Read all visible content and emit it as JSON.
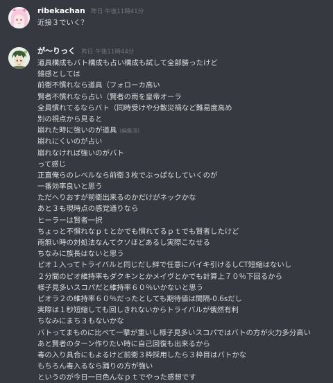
{
  "messages": [
    {
      "username": "ribekachan",
      "timestamp": "昨日 午後11時41分",
      "lines": [
        "近接３でいく？"
      ]
    },
    {
      "username": "が～りっく",
      "timestamp": "昨日 午後11時44分",
      "edited_label": "(編集済)",
      "lines": [
        "道具構成もバト構成も占い構成も試して全部勝ったけど",
        "雑感としては",
        "前衛不慣れなら道具（フォローカ高い",
        "賢者不慣れなら占い（賢者の雨を皇帝オーラ",
        "全員慣れてるならバト（同時受けや分散災禍など難易度高め",
        "別の視点から見ると",
        "崩れた時に強いのが道具",
        "崩れにくいのが占い",
        "崩れなければ強いのがバト",
        "って感じ",
        "正直俺らのレベルなら前衛３枚でぶっぱなしていくのが",
        "一番効率良いと思う",
        "ただへりおすが前衛出来るのかだけがネックかな",
        "あと３も現時点の感覚通りなら",
        "ヒーラーは賢者一択",
        "ちょっと不慣れなｐｔとかでも慣れてるｐｔでも賢者したけど",
        "雨無い時の対処法なんてクソほどあるし実際こなせる",
        "ちなみに族長はないと思う",
        "ピオ１入ってトライバルと同じだし絆で任意にバイキ引けるしCT短縮はないし",
        "２分間のピオ維持率もダクキンとかメイヴとかでも計算上７０％下回るから",
        "様子見多いスコパだと維持率６０％いかないと思う",
        "ピオラ２の維持率６０％だったとしても期待値は間隔-0.6sだし",
        "実際は１秒短縮しても回しきれないからトライバルが俄然有利",
        "ちなみにまち３もないかな",
        "バトってまものに比べて一撃が重いし様子見多いスコパではバトの方が火力多分高い",
        "あと賢者のターン作りたい時に自己回復も出来るから",
        "毒の入り具合にもよるけど前衛３枠採用したら３枠目はバトかな",
        "もちろん毒入るなら踊りの方が強い",
        "というのが今日一日色んなｐｔでやった感想です"
      ]
    }
  ]
}
